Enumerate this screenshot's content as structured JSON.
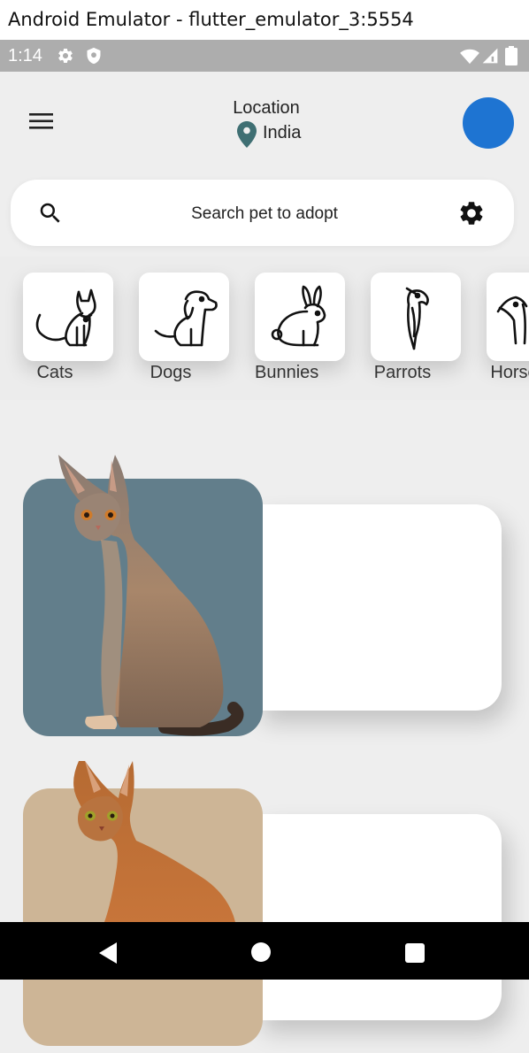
{
  "window": {
    "title": "Android Emulator - flutter_emulator_3:5554"
  },
  "status_bar": {
    "time": "1:14",
    "icons": [
      "gear-icon",
      "shield-icon",
      "wifi-icon",
      "signal-icon",
      "battery-icon"
    ]
  },
  "header": {
    "location_label": "Location",
    "location_value": "India",
    "menu_icon": "hamburger-menu-icon",
    "pin_icon": "location-pin-icon",
    "pin_color": "#3f6f73",
    "avatar_color": "#1e74d2"
  },
  "search": {
    "placeholder": "Search pet to adopt",
    "icon": "search-icon",
    "filter_icon": "gear-icon"
  },
  "categories": [
    {
      "label": "Cats",
      "icon": "cat-icon"
    },
    {
      "label": "Dogs",
      "icon": "dog-icon"
    },
    {
      "label": "Bunnies",
      "icon": "rabbit-icon"
    },
    {
      "label": "Parrots",
      "icon": "parrot-icon"
    },
    {
      "label": "Horses",
      "icon": "horse-icon"
    }
  ],
  "pets": [
    {
      "photo": "abyssinian-cat-photo",
      "bg_color": "#627e8b"
    },
    {
      "photo": "abyssinian-cat-photo",
      "bg_color": "#cdb596"
    }
  ],
  "nav_bar": {
    "icons": [
      "back-icon",
      "home-icon",
      "recents-icon"
    ]
  }
}
